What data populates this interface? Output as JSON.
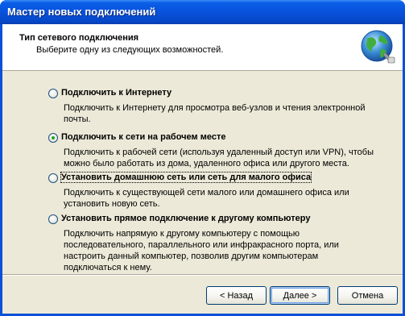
{
  "window": {
    "title": "Мастер новых подключений"
  },
  "header": {
    "title": "Тип сетевого подключения",
    "subtitle": "Выберите одну из следующих возможностей.",
    "icon": "network-globe-icon"
  },
  "options": [
    {
      "label": "Подключить к Интернету",
      "description": "Подключить к Интернету для просмотра веб-узлов и чтения  электронной почты.",
      "selected": false
    },
    {
      "label": "Подключить к сети на рабочем месте",
      "description": "Подключить к рабочей сети (используя удаленный доступ или VPN), чтобы можно было работать из дома, удаленного офиса или другого места.",
      "selected": true
    },
    {
      "label": "Установить домашнюю сеть или сеть для малого офиса",
      "description": "Подключить к существующей сети малого или домашнего офиса или установить новую сеть.",
      "selected": false
    },
    {
      "label": "Установить прямое подключение к другому компьютеру",
      "description": "Подключить напрямую к другому компьютеру с помощью последовательного, параллельного или инфракрасного порта, или настроить данный компьютер, позволив другим  компьютерам подключаться к нему.",
      "selected": false
    }
  ],
  "buttons": {
    "back": "< Назад",
    "next": "Далее >",
    "cancel": "Отмена"
  },
  "colors": {
    "titlebar": "#0852db",
    "dialog_bg": "#ece9d8",
    "radio_dot": "#21a121"
  }
}
